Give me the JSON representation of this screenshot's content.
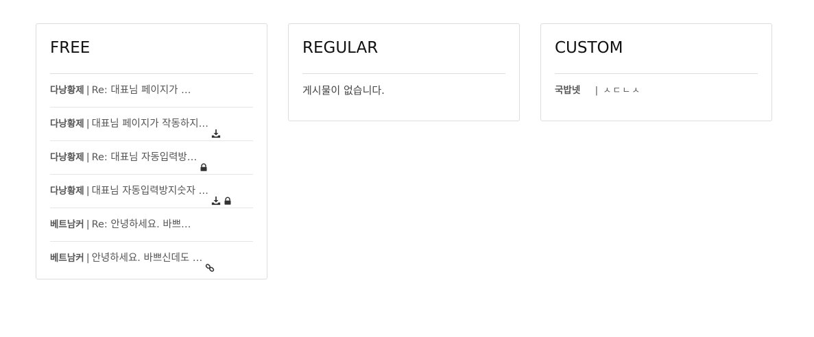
{
  "boards": {
    "free": {
      "title": "FREE",
      "posts": [
        {
          "author": "다낭황제",
          "separator": "|",
          "title": "Re: 대표님 페이지가 …",
          "icons": []
        },
        {
          "author": "다낭황제",
          "separator": "|",
          "title": "대표님 페이지가 작동하지…",
          "icons": [
            "download-icon"
          ]
        },
        {
          "author": "다낭황제",
          "separator": "|",
          "title": "Re: 대표님 자동입력방…",
          "icons": [
            "lock-icon"
          ]
        },
        {
          "author": "다낭황제",
          "separator": "|",
          "title": "대표님 자동입력방지숫자 …",
          "icons": [
            "download-icon",
            "lock-icon"
          ]
        },
        {
          "author": "베트남커",
          "separator": "|",
          "title": "Re: 안녕하세요. 바쁘…",
          "icons": []
        },
        {
          "author": "베트남커",
          "separator": "|",
          "title": "안녕하세요. 바쁘신데도 …",
          "icons": [
            "link-icon"
          ]
        }
      ]
    },
    "regular": {
      "title": "REGULAR",
      "empty_message": "게시물이 없습니다."
    },
    "custom": {
      "title": "CUSTOM",
      "row": {
        "author": "국밥넷",
        "separator": "|",
        "value": "ㅅㄷㄴㅅ"
      }
    }
  },
  "colors": {
    "border": "#dddddd",
    "text": "#555555",
    "title": "#111111"
  }
}
